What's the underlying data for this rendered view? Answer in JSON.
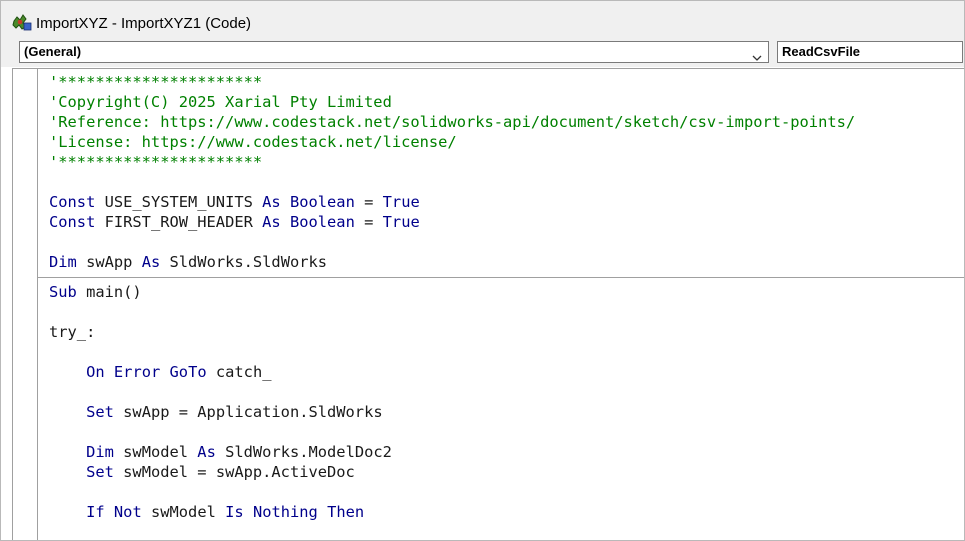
{
  "window": {
    "title": "ImportXYZ - ImportXYZ1 (Code)",
    "icon": "vba-code-icon"
  },
  "toolbar": {
    "object_combo_value": "(General)",
    "procedure_combo_value": "ReadCsvFile"
  },
  "colors": {
    "comment": "#008000",
    "keyword": "#00008b",
    "plain": "#1a1a1a",
    "chrome": "#f0f0f0"
  },
  "code": {
    "lines": [
      {
        "segments": [
          {
            "t": "'**********************",
            "c": "comment"
          }
        ]
      },
      {
        "segments": [
          {
            "t": "'Copyright(C) 2025 Xarial Pty Limited",
            "c": "comment"
          }
        ]
      },
      {
        "segments": [
          {
            "t": "'Reference: https://www.codestack.net/solidworks-api/document/sketch/csv-import-points/",
            "c": "comment"
          }
        ]
      },
      {
        "segments": [
          {
            "t": "'License: https://www.codestack.net/license/",
            "c": "comment"
          }
        ]
      },
      {
        "segments": [
          {
            "t": "'**********************",
            "c": "comment"
          }
        ]
      },
      {
        "segments": []
      },
      {
        "segments": [
          {
            "t": "Const",
            "c": "keyword"
          },
          {
            "t": " USE_SYSTEM_UNITS ",
            "c": "plain"
          },
          {
            "t": "As",
            "c": "keyword"
          },
          {
            "t": " ",
            "c": "plain"
          },
          {
            "t": "Boolean",
            "c": "keyword"
          },
          {
            "t": " = ",
            "c": "plain"
          },
          {
            "t": "True",
            "c": "keyword"
          }
        ]
      },
      {
        "segments": [
          {
            "t": "Const",
            "c": "keyword"
          },
          {
            "t": " FIRST_ROW_HEADER ",
            "c": "plain"
          },
          {
            "t": "As",
            "c": "keyword"
          },
          {
            "t": " ",
            "c": "plain"
          },
          {
            "t": "Boolean",
            "c": "keyword"
          },
          {
            "t": " = ",
            "c": "plain"
          },
          {
            "t": "True",
            "c": "keyword"
          }
        ]
      },
      {
        "segments": []
      },
      {
        "segments": [
          {
            "t": "Dim",
            "c": "keyword"
          },
          {
            "t": " swApp ",
            "c": "plain"
          },
          {
            "t": "As",
            "c": "keyword"
          },
          {
            "t": " SldWorks.SldWorks",
            "c": "plain"
          }
        ]
      },
      {
        "separator": true
      },
      {
        "segments": [
          {
            "t": "Sub",
            "c": "keyword"
          },
          {
            "t": " main()",
            "c": "plain"
          }
        ]
      },
      {
        "segments": []
      },
      {
        "segments": [
          {
            "t": "try_:",
            "c": "plain"
          }
        ]
      },
      {
        "segments": []
      },
      {
        "segments": [
          {
            "t": "    ",
            "c": "plain"
          },
          {
            "t": "On",
            "c": "keyword"
          },
          {
            "t": " ",
            "c": "plain"
          },
          {
            "t": "Error",
            "c": "keyword"
          },
          {
            "t": " ",
            "c": "plain"
          },
          {
            "t": "GoTo",
            "c": "keyword"
          },
          {
            "t": " catch_",
            "c": "plain"
          }
        ]
      },
      {
        "segments": []
      },
      {
        "segments": [
          {
            "t": "    ",
            "c": "plain"
          },
          {
            "t": "Set",
            "c": "keyword"
          },
          {
            "t": " swApp = Application.SldWorks",
            "c": "plain"
          }
        ]
      },
      {
        "segments": []
      },
      {
        "segments": [
          {
            "t": "    ",
            "c": "plain"
          },
          {
            "t": "Dim",
            "c": "keyword"
          },
          {
            "t": " swModel ",
            "c": "plain"
          },
          {
            "t": "As",
            "c": "keyword"
          },
          {
            "t": " SldWorks.ModelDoc2",
            "c": "plain"
          }
        ]
      },
      {
        "segments": [
          {
            "t": "    ",
            "c": "plain"
          },
          {
            "t": "Set",
            "c": "keyword"
          },
          {
            "t": " swModel = swApp.ActiveDoc",
            "c": "plain"
          }
        ]
      },
      {
        "segments": []
      },
      {
        "segments": [
          {
            "t": "    ",
            "c": "plain"
          },
          {
            "t": "If",
            "c": "keyword"
          },
          {
            "t": " ",
            "c": "plain"
          },
          {
            "t": "Not",
            "c": "keyword"
          },
          {
            "t": " swModel ",
            "c": "plain"
          },
          {
            "t": "Is",
            "c": "keyword"
          },
          {
            "t": " ",
            "c": "plain"
          },
          {
            "t": "Nothing",
            "c": "keyword"
          },
          {
            "t": " ",
            "c": "plain"
          },
          {
            "t": "Then",
            "c": "keyword"
          }
        ]
      }
    ]
  }
}
